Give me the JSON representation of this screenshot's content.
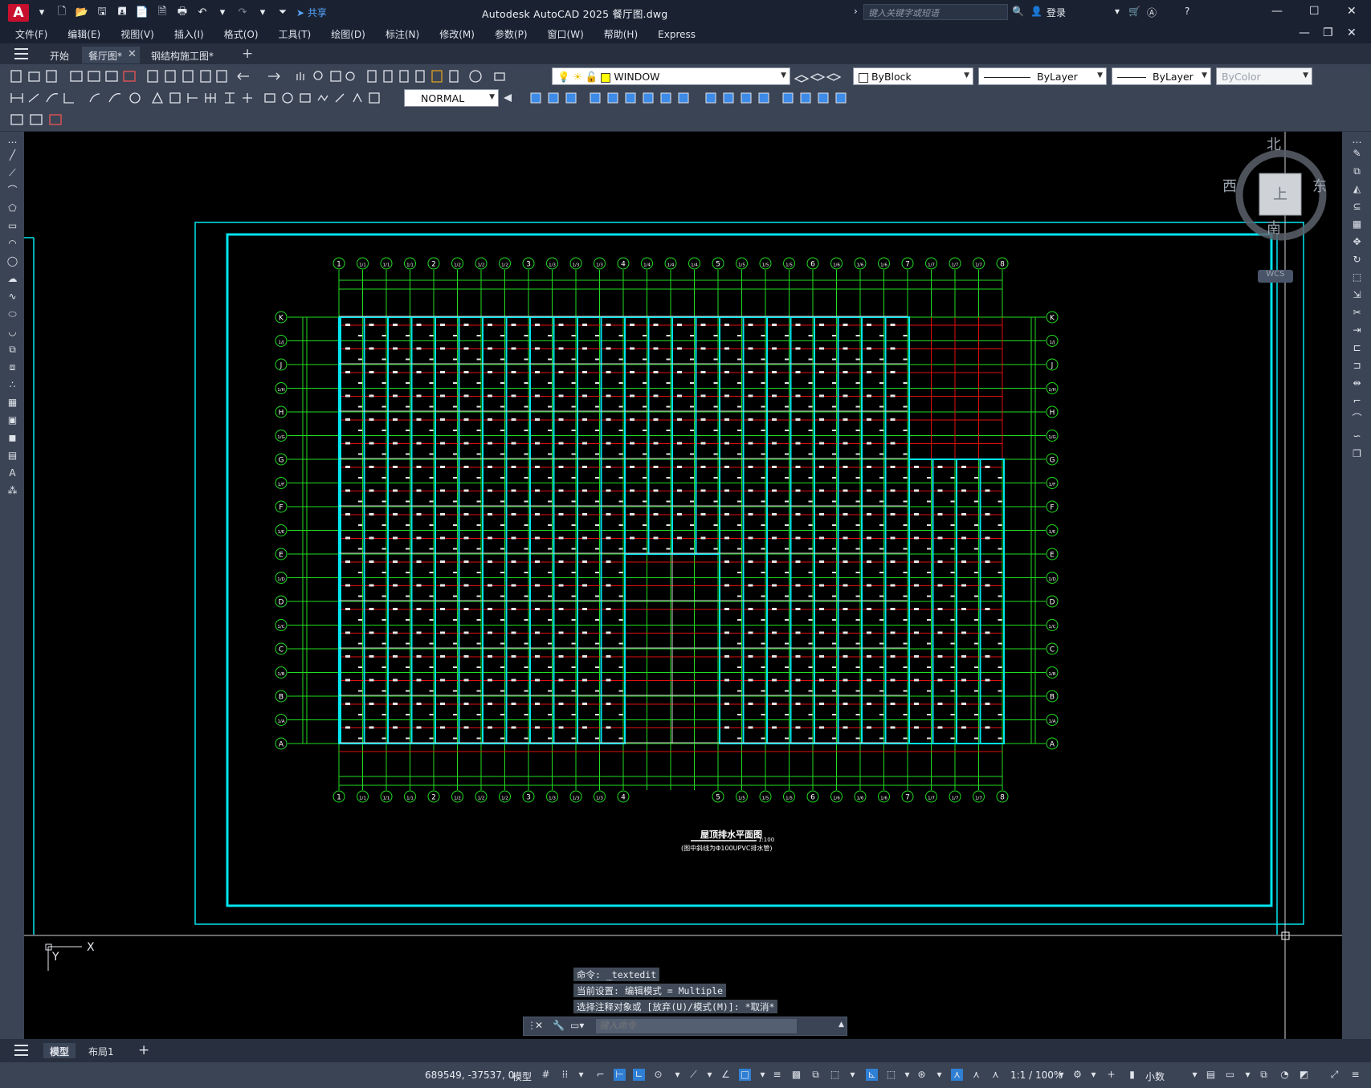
{
  "titlebar": {
    "logo": "A",
    "share": "共享",
    "title": "Autodesk AutoCAD 2025    餐厅图.dwg",
    "search_placeholder": "键入关键字或短语",
    "login": "登录"
  },
  "menu": [
    "文件(F)",
    "编辑(E)",
    "视图(V)",
    "插入(I)",
    "格式(O)",
    "工具(T)",
    "绘图(D)",
    "标注(N)",
    "修改(M)",
    "参数(P)",
    "窗口(W)",
    "帮助(H)",
    "Express"
  ],
  "tabs": {
    "start": "开始",
    "active": "餐厅图*",
    "second": "钢结构施工图*"
  },
  "toolbar": {
    "layer": "WINDOW",
    "color": "ByBlock",
    "linetype": "ByLayer",
    "lineweight": "ByLayer",
    "plotstyle": "ByColor",
    "dimstyle": "NORMAL"
  },
  "viewcube": {
    "north": "北",
    "south": "南",
    "east": "东",
    "west": "西",
    "wcs": "WCS"
  },
  "drawing": {
    "title": "屋顶排水平面图",
    "scale": "1:100",
    "note": "(图中斜线为Φ100UPVC排水管)",
    "col_labels": [
      "1",
      "1/1",
      "1/1",
      "1/1",
      "2",
      "1/2",
      "1/2",
      "1/2",
      "3",
      "1/3",
      "1/3",
      "1/3",
      "4",
      "1/4",
      "1/4",
      "1/4",
      "5",
      "1/5",
      "1/5",
      "1/5",
      "6",
      "1/6",
      "1/6",
      "1/6",
      "7",
      "1/7",
      "1/7",
      "1/7",
      "8"
    ],
    "row_labels": [
      "K",
      "1/J",
      "J",
      "1/H",
      "H",
      "1/G",
      "G",
      "1/F",
      "F",
      "1/E",
      "E",
      "1/D",
      "D",
      "1/C",
      "C",
      "1/B",
      "B",
      "1/A",
      "A"
    ]
  },
  "command": {
    "line1": "命令: _textedit",
    "line2": "当前设置: 编辑模式 = Multiple",
    "line3": "选择注释对象或 [放弃(U)/模式(M)]: *取消*",
    "placeholder": "键入命令"
  },
  "layout_tabs": {
    "model": "模型",
    "layout1": "布局1"
  },
  "status": {
    "coords": "689549, -37537, 0",
    "space": "模型",
    "scale": "1:1 / 100%",
    "units": "小数"
  },
  "ucs": {
    "x": "X",
    "y": "Y"
  },
  "colors": {
    "canvas": "#000000",
    "frame": "#00e5ee",
    "grid": "#22dd22",
    "beam": "#e01010",
    "panel": "#2a3344"
  }
}
